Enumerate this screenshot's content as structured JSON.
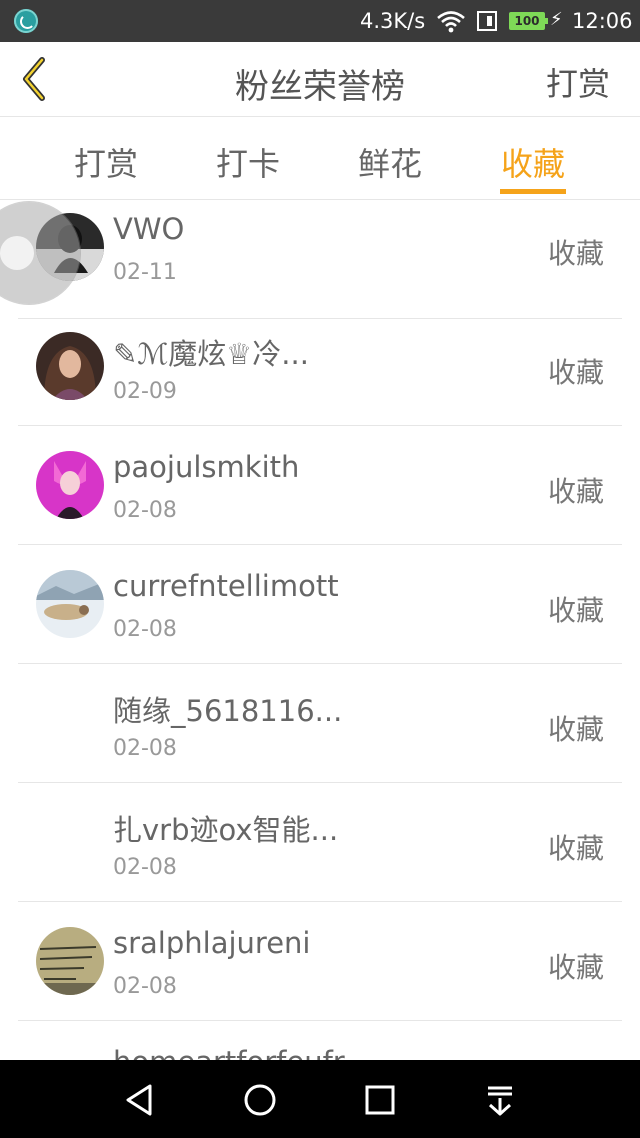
{
  "status_bar": {
    "net_speed": "4.3K/s",
    "battery": "100",
    "time": "12:06"
  },
  "header": {
    "title": "粉丝荣誉榜",
    "right_button": "打赏",
    "back_icon": "chevron-left-icon"
  },
  "tabs": [
    {
      "label": "打赏",
      "active": false
    },
    {
      "label": "打卡",
      "active": false
    },
    {
      "label": "鲜花",
      "active": false
    },
    {
      "label": "收藏",
      "active": true
    }
  ],
  "list": [
    {
      "name": "VWO",
      "date": "02-11",
      "action": "收藏",
      "avatar": "dark-photo"
    },
    {
      "name": "✎ℳ魔炫♕冷...",
      "date": "02-09",
      "action": "收藏",
      "avatar": "warrior-girl"
    },
    {
      "name": "paojulsmkith",
      "date": "02-08",
      "action": "收藏",
      "avatar": "pink-cat-girl"
    },
    {
      "name": "currefntellimott",
      "date": "02-08",
      "action": "收藏",
      "avatar": "seal-on-snow"
    },
    {
      "name": "随缘_5618116...",
      "date": "02-08",
      "action": "收藏",
      "avatar": ""
    },
    {
      "name": "扎vrb迹ox智能...",
      "date": "02-08",
      "action": "收藏",
      "avatar": ""
    },
    {
      "name": "sralphlajureni",
      "date": "02-08",
      "action": "收藏",
      "avatar": "handwriting-note"
    },
    {
      "name": "homeartforfeufr",
      "date": "",
      "action": "",
      "avatar": ""
    }
  ],
  "colors": {
    "accent": "#f5a31a",
    "status_bar": "#3a3a3a",
    "nav_bar": "#000000"
  }
}
